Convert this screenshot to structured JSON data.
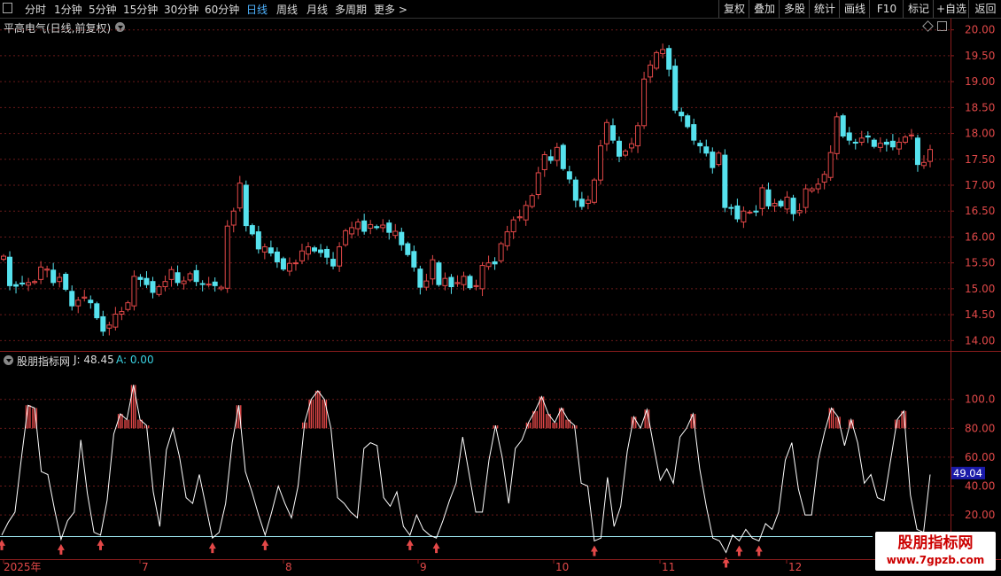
{
  "toolbar": {
    "periods": [
      "分时",
      "1分钟",
      "5分钟",
      "15分钟",
      "30分钟",
      "60分钟",
      "日线",
      "周线",
      "月线",
      "多周期",
      "更多 >"
    ],
    "active_period": "日线",
    "right_buttons": [
      "复权",
      "叠加",
      "多股",
      "统计",
      "画线",
      "F10",
      "标记",
      "+自选",
      "返回"
    ]
  },
  "chart_title": "平高电气(日线,前复权)",
  "indicator": {
    "name": "股朋指标网",
    "j_label": "J: 48.45",
    "a_label": "A: 0.00",
    "current_value_badge": "49.04"
  },
  "x_axis_labels": [
    "2025年",
    "7",
    "8",
    "9",
    "10",
    "11",
    "12"
  ],
  "watermark": {
    "line1": "股朋指标网",
    "line2": "www.7gpzb.com"
  },
  "colors": {
    "up": "#e34848",
    "down": "#56e2ee",
    "grid": "#6a1a1a",
    "axis": "#8a1c1c",
    "indicator_line": "#ffffff",
    "baseline": "#9ee6f0",
    "badge_bg": "#1a1aa8"
  },
  "chart_data": [
    {
      "type": "candlestick",
      "y_ticks": [
        "20.00",
        "19.50",
        "19.00",
        "18.50",
        "18.00",
        "17.50",
        "17.00",
        "16.50",
        "16.00",
        "15.50",
        "15.00",
        "14.50",
        "14.00"
      ],
      "ylim": [
        13.8,
        20.2
      ],
      "close": [
        15.63,
        15.06,
        15.05,
        15.11,
        15.12,
        15.14,
        15.42,
        15.38,
        15.12,
        15.22,
        14.99,
        14.67,
        14.78,
        14.84,
        14.73,
        14.44,
        14.18,
        14.3,
        14.51,
        14.56,
        14.73,
        15.24,
        15.18,
        15.08,
        14.93,
        15.04,
        15.14,
        15.37,
        15.12,
        15.15,
        15.29,
        15.14,
        15.09,
        15.09,
        15.06,
        15.03,
        16.21,
        16.5,
        17.04,
        16.22,
        16.06,
        15.77,
        15.81,
        15.69,
        15.52,
        15.38,
        15.49,
        15.5,
        15.73,
        15.81,
        15.73,
        15.7,
        15.61,
        15.44,
        15.81,
        16.12,
        16.18,
        16.29,
        16.11,
        16.24,
        16.18,
        16.23,
        16.09,
        16.11,
        15.85,
        15.66,
        15.42,
        15.03,
        15.15,
        15.56,
        15.08,
        15.2,
        15.04,
        15.12,
        15.24,
        15.02,
        15.06,
        15.45,
        15.5,
        15.48,
        15.87,
        16.1,
        16.33,
        16.39,
        16.61,
        16.8,
        17.24,
        17.59,
        17.48,
        17.73,
        17.32,
        17.12,
        16.71,
        16.59,
        16.71,
        17.1,
        17.76,
        18.21,
        17.87,
        17.56,
        17.66,
        17.8,
        18.15,
        19.05,
        19.32,
        19.56,
        19.62,
        19.24,
        18.45,
        18.34,
        18.13,
        17.87,
        17.76,
        17.62,
        17.34,
        17.62,
        16.57,
        16.56,
        16.35,
        16.5,
        16.48,
        16.49,
        16.95,
        16.6,
        16.65,
        16.6,
        16.77,
        16.45,
        16.51,
        16.93,
        16.93,
        17.02,
        17.21,
        17.63,
        18.32,
        17.95,
        17.87,
        17.83,
        17.91,
        17.93,
        17.75,
        17.81,
        17.79,
        17.74,
        17.83,
        17.93,
        17.97,
        17.4,
        17.44,
        17.69
      ],
      "volume_note": ""
    },
    {
      "type": "line",
      "y_ticks": [
        "100.0",
        "80.00",
        "60.00",
        "40.00",
        "20.00"
      ],
      "ylim": [
        -10,
        125
      ],
      "series": [
        {
          "values": [
            6,
            15,
            22,
            60,
            96,
            94,
            50,
            48,
            24,
            3,
            16,
            22,
            72,
            35,
            8,
            6,
            30,
            76,
            90,
            86,
            110,
            86,
            82,
            36,
            12,
            65,
            80,
            60,
            32,
            28,
            48,
            26,
            4,
            8,
            28,
            70,
            96,
            50,
            36,
            20,
            6,
            22,
            40,
            28,
            18,
            40,
            84,
            100,
            106,
            100,
            80,
            32,
            28,
            22,
            18,
            66,
            70,
            68,
            32,
            26,
            36,
            12,
            6,
            20,
            10,
            6,
            4,
            16,
            30,
            42,
            74,
            48,
            22,
            22,
            58,
            82,
            60,
            28,
            66,
            72,
            84,
            92,
            102,
            90,
            84,
            94,
            86,
            82,
            42,
            40,
            2,
            4,
            46,
            12,
            26,
            64,
            88,
            80,
            93,
            68,
            44,
            52,
            42,
            74,
            80,
            90,
            52,
            26,
            4,
            2,
            -6,
            6,
            2,
            10,
            4,
            2,
            14,
            10,
            22,
            58,
            70,
            38,
            20,
            20,
            58,
            78,
            94,
            88,
            68,
            86,
            70,
            42,
            48,
            32,
            30,
            58,
            86,
            92,
            34,
            10,
            8,
            48
          ]
        }
      ]
    }
  ]
}
